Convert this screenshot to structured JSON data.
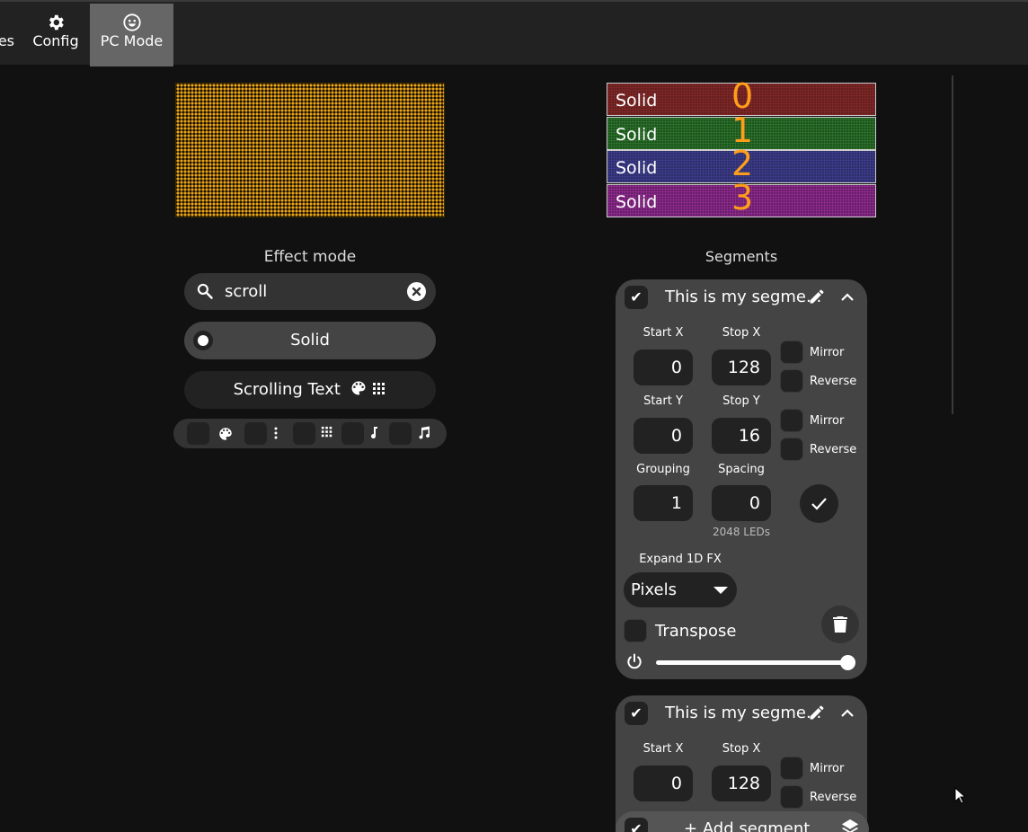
{
  "nav": {
    "partial_tab_label": "es",
    "tabs": [
      {
        "label": "Config",
        "icon": "gear-icon"
      },
      {
        "label": "PC Mode",
        "icon": "smiley-icon",
        "active": true
      }
    ]
  },
  "effects": {
    "title": "Effect mode",
    "search_value": "scroll",
    "items": [
      {
        "label": "Solid",
        "selected": true
      },
      {
        "label": "Scrolling Text",
        "flags": [
          "palette-icon",
          "matrix-2d-icon"
        ]
      }
    ],
    "filters": [
      "palette-icon",
      "vertical-dots-icon",
      "matrix-2d-icon",
      "note-icon",
      "double-note-icon"
    ]
  },
  "segment_preview": [
    {
      "label": "Solid",
      "number": "0",
      "color": "#5a1c1c"
    },
    {
      "label": "Solid",
      "number": "1",
      "color": "#1a4a1a"
    },
    {
      "label": "Solid",
      "number": "2",
      "color": "#2a2a5a"
    },
    {
      "label": "Solid",
      "number": "3",
      "color": "#5a1a5a"
    }
  ],
  "segments": {
    "title": "Segments",
    "cards": [
      {
        "name": "This is my segme...",
        "start_x_label": "Start X",
        "start_x": "0",
        "stop_x_label": "Stop X",
        "stop_x": "128",
        "start_y_label": "Start Y",
        "start_y": "0",
        "stop_y_label": "Stop Y",
        "stop_y": "16",
        "grouping_label": "Grouping",
        "grouping": "1",
        "spacing_label": "Spacing",
        "spacing": "0",
        "mirror_label": "Mirror",
        "reverse_label": "Reverse",
        "led_count": "2048 LEDs",
        "expand_label": "Expand 1D FX",
        "expand_value": "Pixels",
        "transpose_label": "Transpose",
        "brightness_fraction": 1.0
      },
      {
        "name": "This is my segme...",
        "start_x_label": "Start X",
        "start_x": "0",
        "stop_x_label": "Stop X",
        "stop_x": "128",
        "mirror_label": "Mirror",
        "reverse_label": "Reverse"
      }
    ],
    "add_label": "Add segment"
  },
  "colors": {
    "accent": "#ff9e1b",
    "background": "#111111",
    "card": "#444444"
  }
}
